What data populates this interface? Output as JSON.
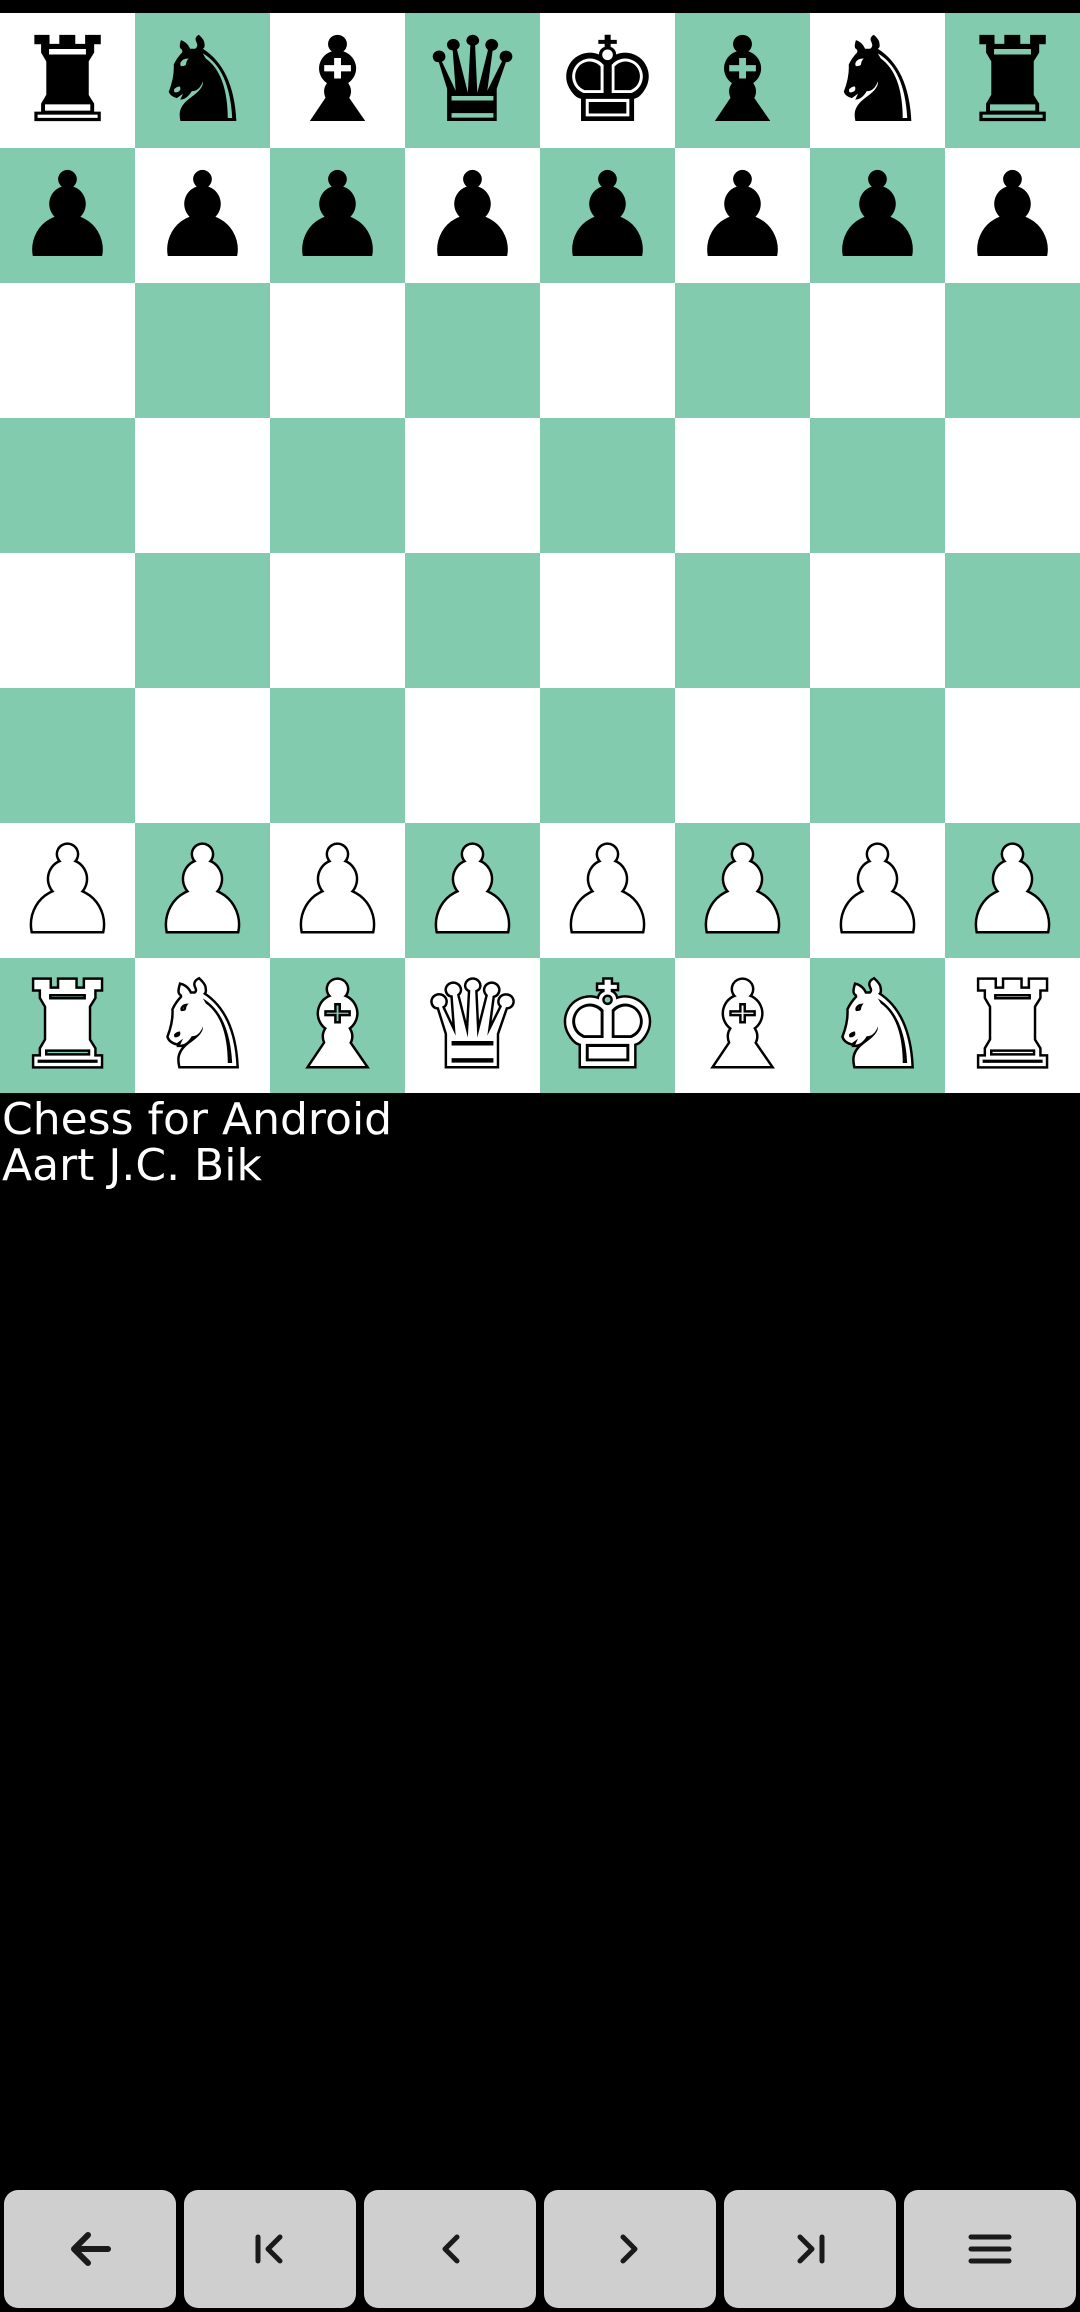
{
  "board": {
    "light_color": "#ffffff",
    "dark_color": "#82cbaf",
    "ranks": [
      [
        {
          "p": "♜",
          "c": "black"
        },
        {
          "p": "♞",
          "c": "black"
        },
        {
          "p": "♝",
          "c": "black"
        },
        {
          "p": "♛",
          "c": "black"
        },
        {
          "p": "♚",
          "c": "black"
        },
        {
          "p": "♝",
          "c": "black"
        },
        {
          "p": "♞",
          "c": "black"
        },
        {
          "p": "♜",
          "c": "black"
        }
      ],
      [
        {
          "p": "♟",
          "c": "black"
        },
        {
          "p": "♟",
          "c": "black"
        },
        {
          "p": "♟",
          "c": "black"
        },
        {
          "p": "♟",
          "c": "black"
        },
        {
          "p": "♟",
          "c": "black"
        },
        {
          "p": "♟",
          "c": "black"
        },
        {
          "p": "♟",
          "c": "black"
        },
        {
          "p": "♟",
          "c": "black"
        }
      ],
      [
        null,
        null,
        null,
        null,
        null,
        null,
        null,
        null
      ],
      [
        null,
        null,
        null,
        null,
        null,
        null,
        null,
        null
      ],
      [
        null,
        null,
        null,
        null,
        null,
        null,
        null,
        null
      ],
      [
        null,
        null,
        null,
        null,
        null,
        null,
        null,
        null
      ],
      [
        {
          "p": "♟",
          "c": "white"
        },
        {
          "p": "♟",
          "c": "white"
        },
        {
          "p": "♟",
          "c": "white"
        },
        {
          "p": "♟",
          "c": "white"
        },
        {
          "p": "♟",
          "c": "white"
        },
        {
          "p": "♟",
          "c": "white"
        },
        {
          "p": "♟",
          "c": "white"
        },
        {
          "p": "♟",
          "c": "white"
        }
      ],
      [
        {
          "p": "♜",
          "c": "white"
        },
        {
          "p": "♞",
          "c": "white"
        },
        {
          "p": "♝",
          "c": "white"
        },
        {
          "p": "♛",
          "c": "white"
        },
        {
          "p": "♚",
          "c": "white"
        },
        {
          "p": "♝",
          "c": "white"
        },
        {
          "p": "♞",
          "c": "white"
        },
        {
          "p": "♜",
          "c": "white"
        }
      ]
    ]
  },
  "info": {
    "line1": "Chess for Android",
    "line2": "Aart J.C. Bik"
  },
  "nav": {
    "button_color": "#cfcfcf",
    "buttons": [
      {
        "name": "back-button",
        "icon": "arrow-left-icon"
      },
      {
        "name": "first-move-button",
        "icon": "skip-to-start-icon"
      },
      {
        "name": "previous-move-button",
        "icon": "chevron-left-icon"
      },
      {
        "name": "next-move-button",
        "icon": "chevron-right-icon"
      },
      {
        "name": "last-move-button",
        "icon": "skip-to-end-icon"
      },
      {
        "name": "menu-button",
        "icon": "menu-icon"
      }
    ]
  }
}
